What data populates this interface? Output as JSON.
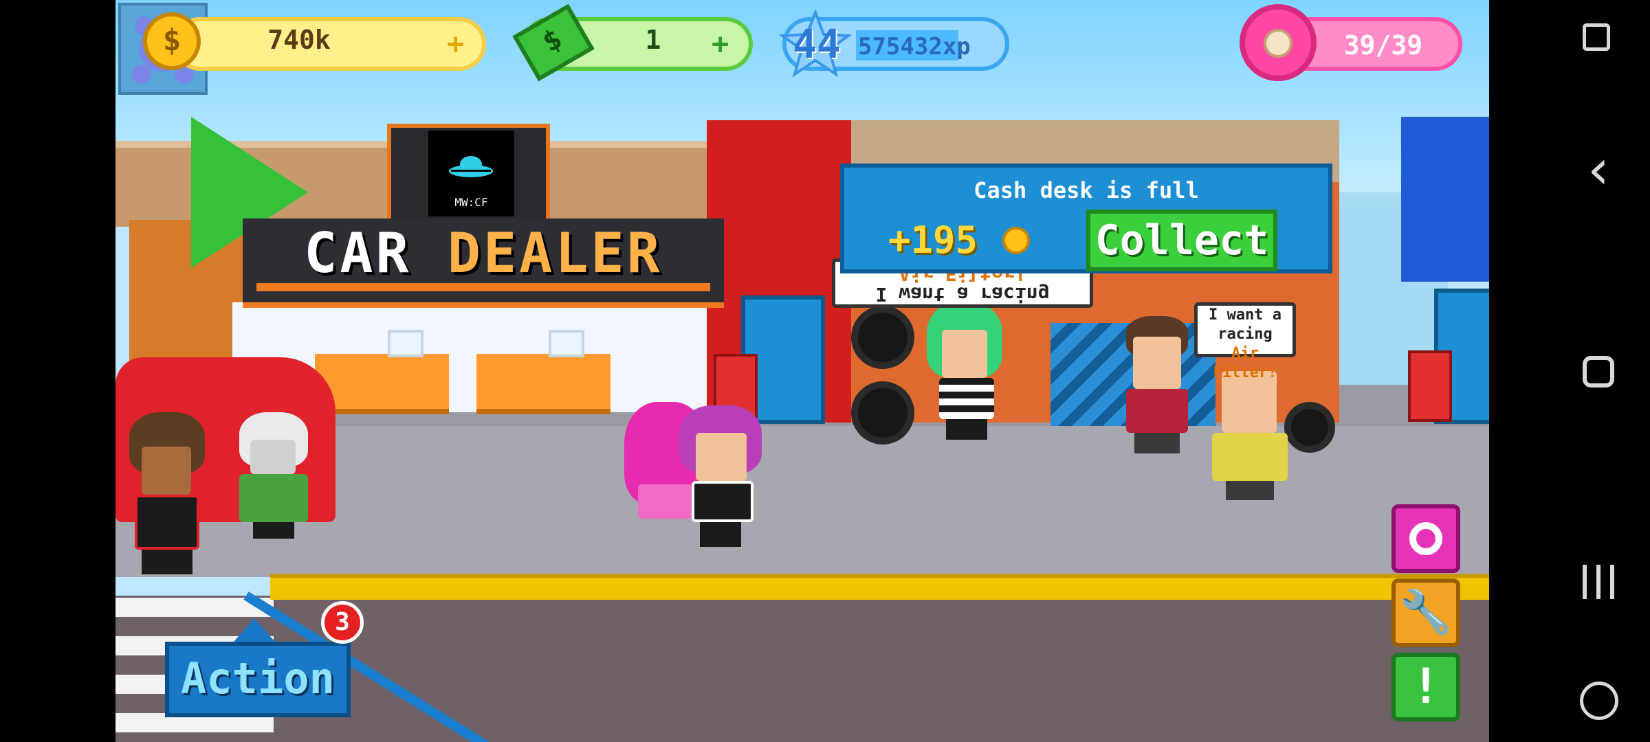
{
  "hud": {
    "coins": "740k",
    "coin_icon": "$",
    "coin_plus": "+",
    "cash": "1",
    "cash_plus": "+",
    "level": "44",
    "xp": "575432xp",
    "xp_progress": 0.55,
    "donuts": "39/39"
  },
  "building": {
    "sign_main": "CAR",
    "sign_highlight": "DEALER",
    "tower_label": "MW:CF"
  },
  "cash_desk": {
    "title": "Cash desk is full",
    "amount": "+195",
    "collect_label": "Collect"
  },
  "bubbles": {
    "customer1_line1": "I want a racing",
    "customer1_line2": "Air Filter!",
    "customer2_line1": "I want a racing",
    "customer2_line2": "Air Filter!"
  },
  "action": {
    "label": "Action",
    "badge": "3"
  },
  "side_buttons": {
    "wrench": "🔧",
    "alert": "!"
  },
  "system_nav": {
    "back": "‹"
  },
  "colors": {
    "sky": "#7fd4ff",
    "accent_orange": "#f07a1f",
    "collect_green": "#3ccf3c",
    "panel_blue": "#1f8fd4",
    "donut_pink": "#ff47a3"
  }
}
